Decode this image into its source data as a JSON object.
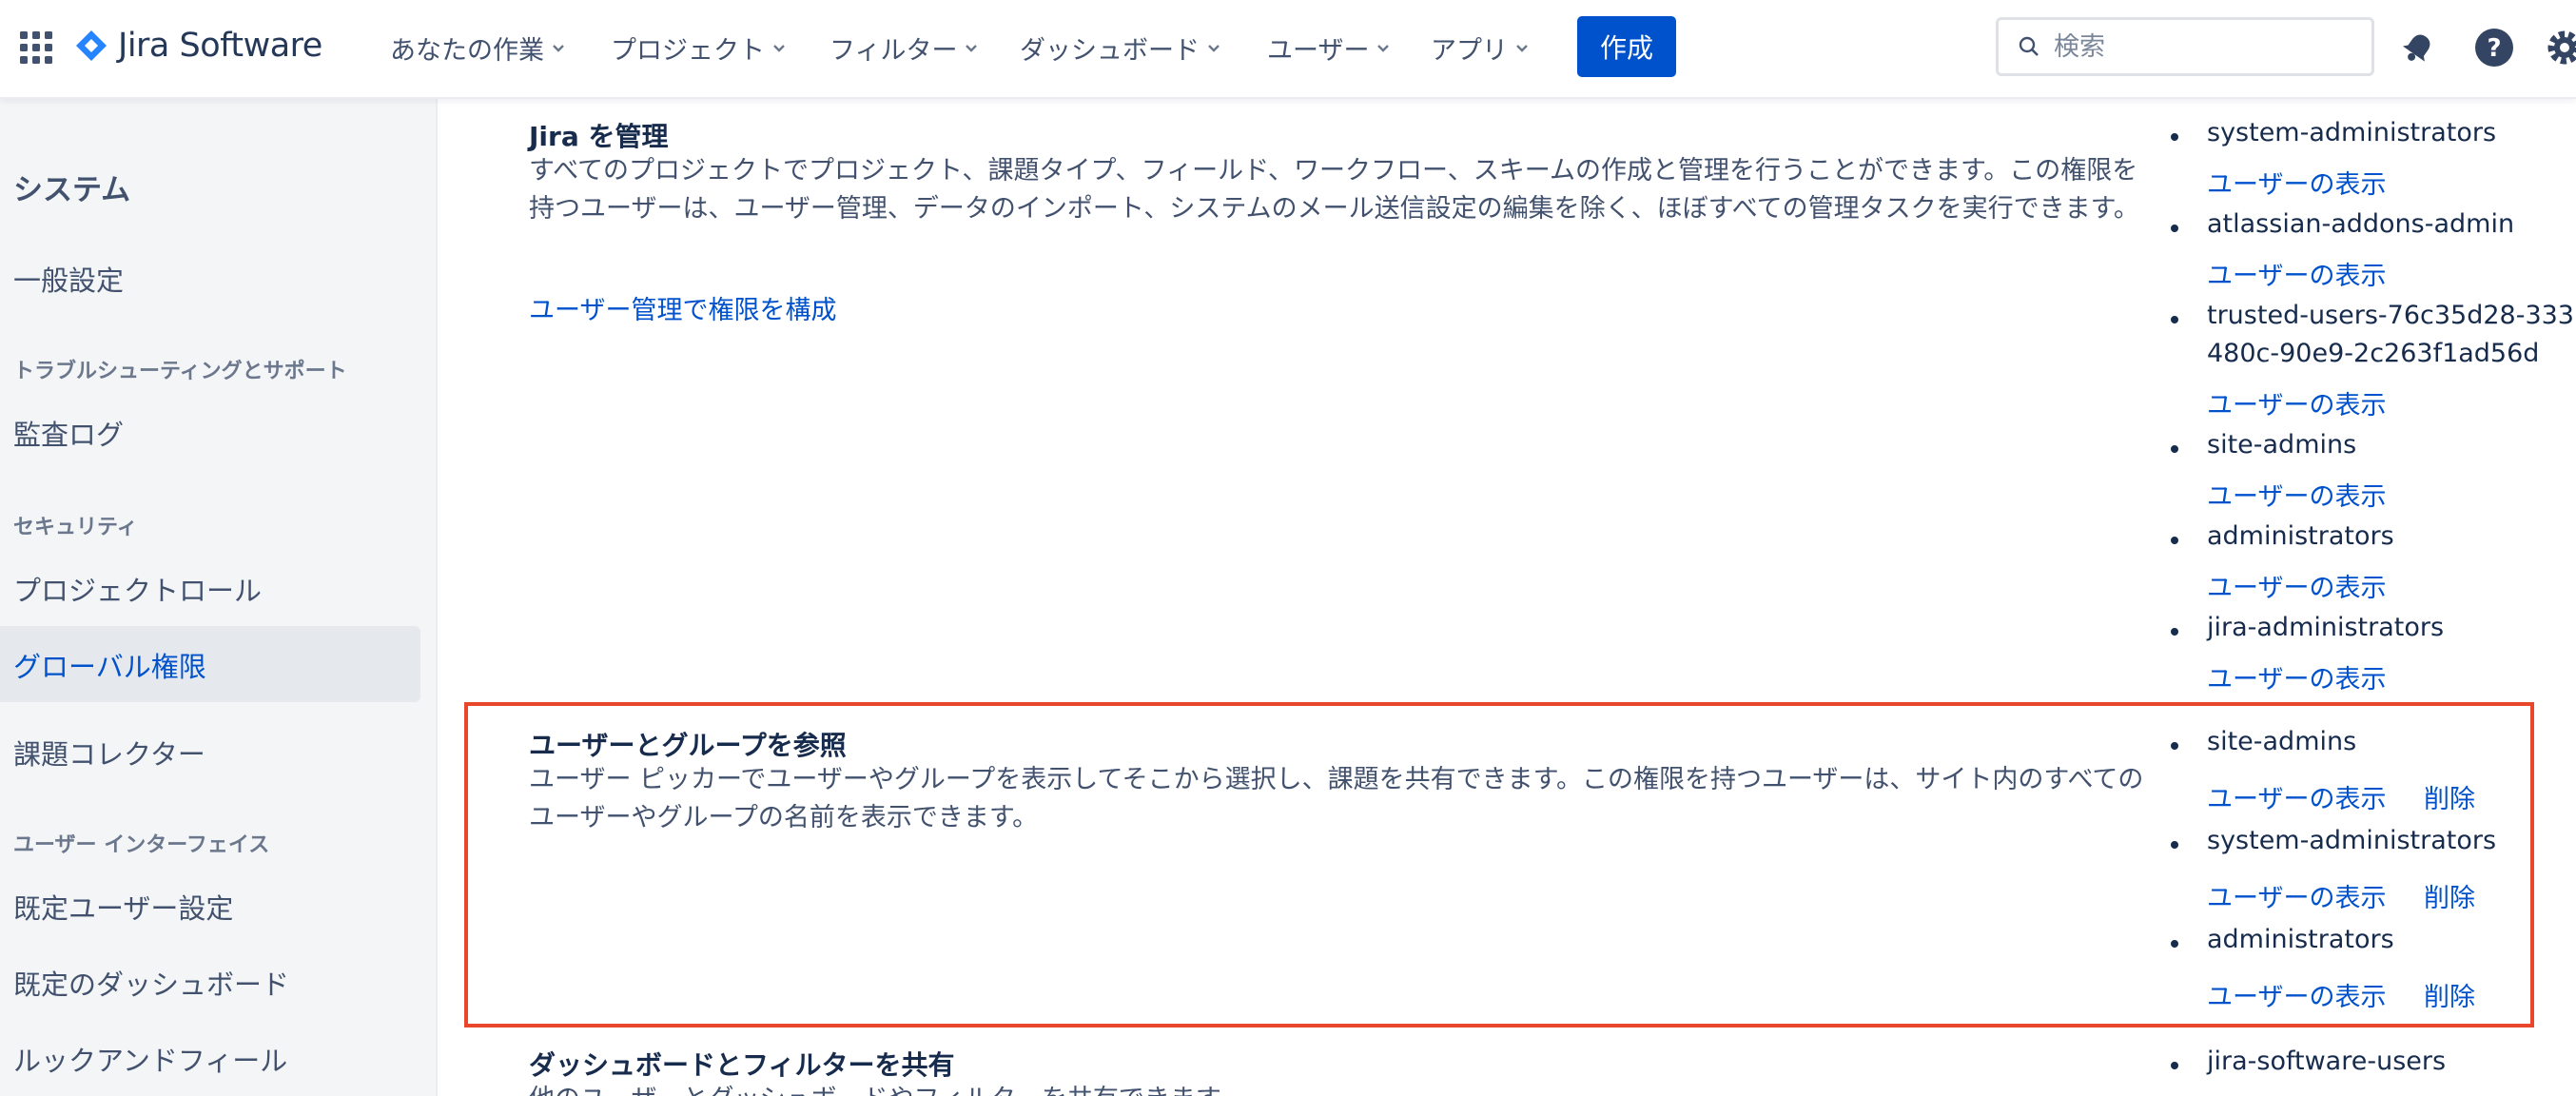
{
  "topbar": {
    "app_name": "Jira Software",
    "nav": [
      {
        "label": "あなたの作業"
      },
      {
        "label": "プロジェクト"
      },
      {
        "label": "フィルター"
      },
      {
        "label": "ダッシュボード"
      },
      {
        "label": "ユーザー"
      },
      {
        "label": "アプリ"
      }
    ],
    "create_label": "作成",
    "search_placeholder": "検索",
    "icons": [
      "app-switcher-icon",
      "jira-logo-icon",
      "search-icon",
      "notification-icon",
      "help-icon",
      "settings-icon"
    ]
  },
  "sidebar": {
    "heading": "システム",
    "general": "一般設定",
    "section_troubleshooting": "トラブルシューティングとサポート",
    "audit_log": "監査ログ",
    "section_security": "セキュリティ",
    "project_roles": "プロジェクトロール",
    "global_permissions": "グローバル権限",
    "issue_collectors": "課題コレクター",
    "section_ui": "ユーザー インターフェイス",
    "default_user_prefs": "既定ユーザー設定",
    "default_dashboard": "既定のダッシュボード",
    "look_and_feel": "ルックアンドフィール"
  },
  "permissions": [
    {
      "title": "Jira を管理",
      "description": "すべてのプロジェクトでプロジェクト、課題タイプ、フィールド、ワークフロー、スキームの作成と管理を行うことができます。この権限を持つユーザーは、ユーザー管理、データのインポート、システムのメール送信設定の編集を除く、ほぼすべての管理タスクを実行できます。",
      "config_link": "ユーザー管理で権限を構成",
      "groups": [
        {
          "name": "system-administrators",
          "view": "ユーザーの表示"
        },
        {
          "name": "atlassian-addons-admin",
          "view": "ユーザーの表示"
        },
        {
          "name": "trusted-users-76c35d28-333",
          "name2": "480c-90e9-2c263f1ad56d",
          "view": "ユーザーの表示"
        },
        {
          "name": "site-admins",
          "view": "ユーザーの表示"
        },
        {
          "name": "administrators",
          "view": "ユーザーの表示"
        },
        {
          "name": "jira-administrators",
          "view": "ユーザーの表示"
        }
      ]
    },
    {
      "title": "ユーザーとグループを参照",
      "description": "ユーザー ピッカーでユーザーやグループを表示してそこから選択し、課題を共有できます。この権限を持つユーザーは、サイト内のすべてのユーザーやグループの名前を表示できます。",
      "groups": [
        {
          "name": "site-admins",
          "view": "ユーザーの表示",
          "delete": "削除"
        },
        {
          "name": "system-administrators",
          "view": "ユーザーの表示",
          "delete": "削除"
        },
        {
          "name": "administrators",
          "view": "ユーザーの表示",
          "delete": "削除"
        }
      ]
    },
    {
      "title": "ダッシュボードとフィルターを共有",
      "description": "他のユーザーとダッシュボードやフィルターを共有できます。",
      "groups": [
        {
          "name": "jira-software-users"
        }
      ]
    }
  ],
  "colors": {
    "accent": "#0052cc",
    "highlight": "#e8472b",
    "sidebar_bg": "#f4f5f7"
  }
}
